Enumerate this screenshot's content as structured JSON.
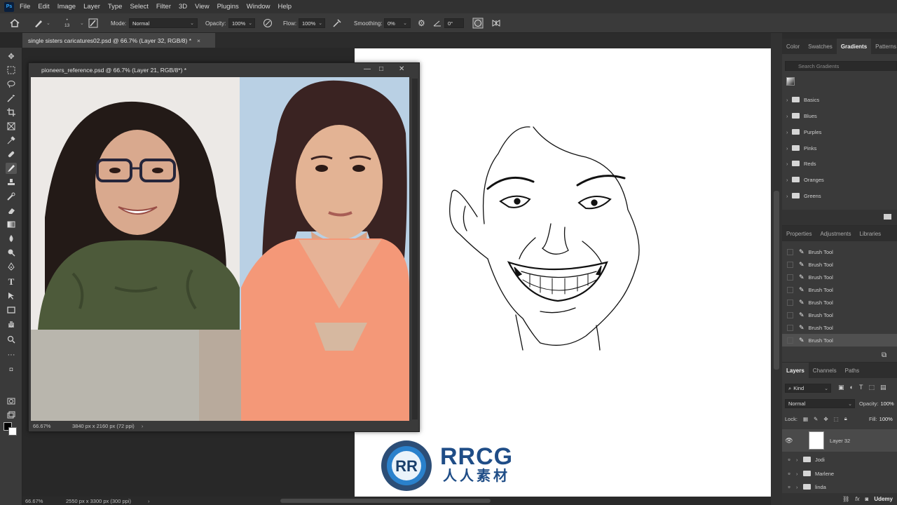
{
  "menu": {
    "logo": "Ps",
    "items": [
      "File",
      "Edit",
      "Image",
      "Layer",
      "Type",
      "Select",
      "Filter",
      "3D",
      "View",
      "Plugins",
      "Window",
      "Help"
    ]
  },
  "options": {
    "brush_size": "13",
    "mode_label": "Mode:",
    "mode_value": "Normal",
    "opacity_label": "Opacity:",
    "opacity_value": "100%",
    "flow_label": "Flow:",
    "flow_value": "100%",
    "smoothing_label": "Smoothing:",
    "smoothing_value": "0%",
    "angle_value": "0°"
  },
  "document": {
    "tab_title": "single sisters caricatures02.psd @ 66.7% (Layer 32, RGB/8) *",
    "zoom": "66.67%",
    "dimensions": "2550 px x 3300 px (300 ppi)"
  },
  "float_window": {
    "title": "pioneers_reference.psd @ 66.7% (Layer 21, RGB/8*) *",
    "zoom": "66.67%",
    "dimensions": "3840 px x 2160 px (72 ppi)"
  },
  "panels": {
    "top_tabs": [
      "Color",
      "Swatches",
      "Gradients",
      "Patterns"
    ],
    "search_placeholder": "Search Gradients",
    "gradient_groups": [
      "Basics",
      "Blues",
      "Purples",
      "Pinks",
      "Reds",
      "Oranges",
      "Greens"
    ],
    "mid_tabs": [
      "Properties",
      "Adjustments",
      "Libraries"
    ],
    "history": [
      "Brush Tool",
      "Brush Tool",
      "Brush Tool",
      "Brush Tool",
      "Brush Tool",
      "Brush Tool",
      "Brush Tool",
      "Brush Tool"
    ],
    "layer_tabs": [
      "Layers",
      "Channels",
      "Paths"
    ],
    "kind_label": "Kind",
    "blend_mode": "Normal",
    "opacity_label": "Opacity:",
    "opacity_value": "100%",
    "lock_label": "Lock:",
    "fill_label": "Fill:",
    "fill_value": "100%",
    "layers": [
      "Layer 32",
      "Jodi",
      "Marlene",
      "linda"
    ]
  },
  "watermark": {
    "brand": "RRCG",
    "subtitle": "人人素材",
    "corner": "Udemy"
  }
}
